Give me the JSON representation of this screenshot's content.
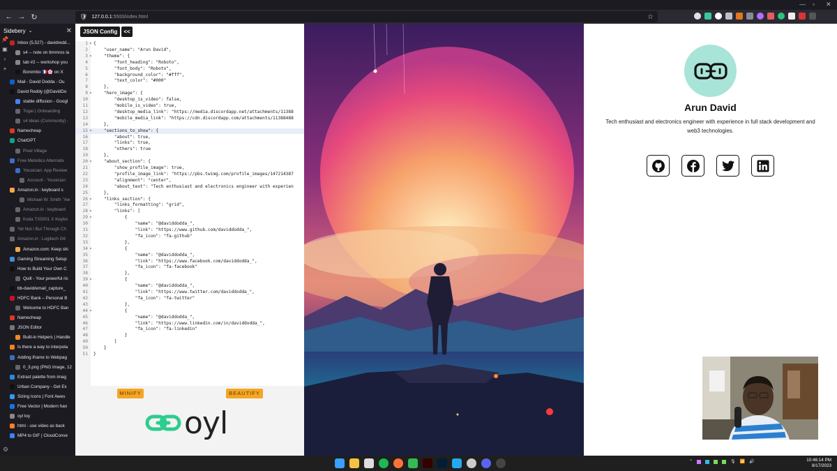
{
  "browser": {
    "url_host": "127.0.0.1",
    "url_rest": ":5500/index.html",
    "sidebar_title": "Sidebery"
  },
  "sidebar": {
    "items": [
      {
        "label": "Inbox (5,527) - davidredd...",
        "color": "#c5221f",
        "indent": 0
      },
      {
        "label": "s4 -- note on timmros la",
        "color": "#888888",
        "indent": 1
      },
      {
        "label": "tab #2 -- workshop you",
        "color": "#888888",
        "indent": 1
      },
      {
        "label": "Borombo 🇫🇷🌸 on X",
        "color": "#111111",
        "indent": 1
      },
      {
        "label": "Mail - David Dodda - Ou",
        "color": "#0a64c8",
        "indent": 0
      },
      {
        "label": "David Reddy (@DavidDo",
        "color": "#111111",
        "indent": 0
      },
      {
        "label": "stable diffusion - Googl",
        "color": "#4285f4",
        "indent": 1
      },
      {
        "label": "Togai | Onboarding",
        "color": "#666666",
        "indent": 1,
        "dim": true
      },
      {
        "label": "s4 ideas (Community) -",
        "color": "#666666",
        "indent": 1,
        "dim": true
      },
      {
        "label": "Namecheap",
        "color": "#de3723",
        "indent": 0
      },
      {
        "label": "ChatGPT",
        "color": "#10a37f",
        "indent": 0
      },
      {
        "label": "Pixel Village",
        "color": "#666666",
        "indent": 1,
        "dim": true
      },
      {
        "label": "Free Melodics Alternativ",
        "color": "#3d6dc5",
        "indent": 0,
        "dim": true
      },
      {
        "label": "Yousician: App Review",
        "color": "#3d6dc5",
        "indent": 1,
        "dim": true
      },
      {
        "label": "Account - Yousician",
        "color": "#666666",
        "indent": 2,
        "dim": true
      },
      {
        "label": "Amazon.in : keyboard s",
        "color": "#f3a847",
        "indent": 0
      },
      {
        "label": "Michael W. Smith \"Aw",
        "color": "#666666",
        "indent": 2,
        "dim": true
      },
      {
        "label": "Amazon.in : keyboard",
        "color": "#666666",
        "indent": 1,
        "dim": true
      },
      {
        "label": "Koda TX5001 X Keybo",
        "color": "#666666",
        "indent": 1,
        "dim": true
      },
      {
        "label": "Yet Not I But Through Ch",
        "color": "#666666",
        "indent": 0,
        "dim": true
      },
      {
        "label": "Amazon.in : Logitech G6",
        "color": "#666666",
        "indent": 0,
        "dim": true
      },
      {
        "label": "Amazon.com: Keep shi",
        "color": "#f3a847",
        "indent": 1
      },
      {
        "label": "Gaming Streaming Setup",
        "color": "#3f8fd8",
        "indent": 0
      },
      {
        "label": "How to Build Your Own C",
        "color": "#111111",
        "indent": 0
      },
      {
        "label": "Quill - Your powerful ric",
        "color": "#666666",
        "indent": 1
      },
      {
        "label": "bb-david/email_capture_",
        "color": "#111111",
        "indent": 0
      },
      {
        "label": "HDFC Bank – Personal B",
        "color": "#c8102e",
        "indent": 0
      },
      {
        "label": "Welcome to HDFC Ban",
        "color": "#666666",
        "indent": 1
      },
      {
        "label": "Namecheap",
        "color": "#de3723",
        "indent": 0
      },
      {
        "label": "JSON Editor",
        "color": "#777777",
        "indent": 0
      },
      {
        "label": "Built-in Helpers | Handle",
        "color": "#f08a24",
        "indent": 1
      },
      {
        "label": "Is there a way to interpola",
        "color": "#f48024",
        "indent": 0
      },
      {
        "label": "Adding iframe to Webpag",
        "color": "#3d6dc5",
        "indent": 0
      },
      {
        "label": "0_3.png (PNG Image, 12",
        "color": "#666666",
        "indent": 1
      },
      {
        "label": "Extract palette from imag",
        "color": "#2b88d8",
        "indent": 0
      },
      {
        "label": "Urban Company - Get Ex",
        "color": "#111111",
        "indent": 0
      },
      {
        "label": "Sizing Icons | Font Awes",
        "color": "#339af0",
        "indent": 0
      },
      {
        "label": "Free Vector | Modern han",
        "color": "#1273eb",
        "indent": 0
      },
      {
        "label": "oyl toy",
        "color": "#888888",
        "indent": 0
      },
      {
        "label": "html - use video as back",
        "color": "#f48024",
        "indent": 0
      },
      {
        "label": "MP4 to GIF | CloudConve",
        "color": "#3b82f6",
        "indent": 0
      }
    ]
  },
  "editor": {
    "json_config_label": "JSON Config",
    "collapse_label": "<<",
    "minify_label": "MINIFY",
    "beautify_label": "BEAUTIFY",
    "logo_text": "oyl",
    "active_line": 15,
    "lines": [
      {
        "n": "1",
        "fold": "▾",
        "text": "{"
      },
      {
        "n": "2",
        "fold": "",
        "text": "    \"user_name\": \"Arun David\","
      },
      {
        "n": "3",
        "fold": "▾",
        "text": "    \"theme\": {"
      },
      {
        "n": "4",
        "fold": "",
        "text": "        \"font_heading\": \"Roboto\","
      },
      {
        "n": "5",
        "fold": "",
        "text": "        \"font_body\": \"Roboto\","
      },
      {
        "n": "6",
        "fold": "",
        "text": "        \"background_color\": \"#fff\","
      },
      {
        "n": "7",
        "fold": "",
        "text": "        \"text_color\": \"#000\""
      },
      {
        "n": "8",
        "fold": "",
        "text": "    },"
      },
      {
        "n": "9",
        "fold": "▾",
        "text": "    \"hero_image\": {"
      },
      {
        "n": "10",
        "fold": "",
        "text": "        \"desktop_is_video\": false,"
      },
      {
        "n": "11",
        "fold": "",
        "text": "        \"mobile_is_video\": true,"
      },
      {
        "n": "12",
        "fold": "",
        "text": "        \"desktop_media_link\": \"https://media.discordapp.net/attachments/11388"
      },
      {
        "n": "13",
        "fold": "",
        "text": "        \"mobile_media_link\": \"https://cdn.discordapp.com/attachments/11388488"
      },
      {
        "n": "14",
        "fold": "",
        "text": "    },"
      },
      {
        "n": "15",
        "fold": "▾",
        "text": "    \"sections_to_show\": {"
      },
      {
        "n": "16",
        "fold": "",
        "text": "        \"about\": true,"
      },
      {
        "n": "17",
        "fold": "",
        "text": "        \"links\": true,"
      },
      {
        "n": "18",
        "fold": "",
        "text": "        \"others\": true"
      },
      {
        "n": "19",
        "fold": "",
        "text": "    },"
      },
      {
        "n": "20",
        "fold": "▾",
        "text": "    \"about_section\": {"
      },
      {
        "n": "21",
        "fold": "",
        "text": "        \"show_profile_image\": true,"
      },
      {
        "n": "22",
        "fold": "",
        "text": "        \"profile_image_link\": \"https://pbs.twimg.com/profile_images/147214387"
      },
      {
        "n": "23",
        "fold": "",
        "text": "        \"alignment\": \"center\","
      },
      {
        "n": "24",
        "fold": "",
        "text": "        \"about_text\": \"Tech enthusiast and electronics engineer with experien"
      },
      {
        "n": "25",
        "fold": "",
        "text": "    },"
      },
      {
        "n": "26",
        "fold": "▾",
        "text": "    \"links_section\": {"
      },
      {
        "n": "27",
        "fold": "",
        "text": "        \"links_formatting\": \"grid\","
      },
      {
        "n": "28",
        "fold": "▾",
        "text": "        \"links\": ["
      },
      {
        "n": "29",
        "fold": "▾",
        "text": "            {"
      },
      {
        "n": "30",
        "fold": "",
        "text": "                \"name\": \"@daviddodda_\","
      },
      {
        "n": "31",
        "fold": "",
        "text": "                \"link\": \"https://www.github.com/daviddodda_\","
      },
      {
        "n": "32",
        "fold": "",
        "text": "                \"fa_icon\": \"fa-github\""
      },
      {
        "n": "33",
        "fold": "",
        "text": "            },"
      },
      {
        "n": "34",
        "fold": "▾",
        "text": "            {"
      },
      {
        "n": "35",
        "fold": "",
        "text": "                \"name\": \"@daviddodda_\","
      },
      {
        "n": "36",
        "fold": "",
        "text": "                \"link\": \"https://www.facebook.com/daviddodda_\","
      },
      {
        "n": "37",
        "fold": "",
        "text": "                \"fa_icon\": \"fa-facebook\""
      },
      {
        "n": "38",
        "fold": "",
        "text": "            },"
      },
      {
        "n": "39",
        "fold": "▾",
        "text": "            {"
      },
      {
        "n": "40",
        "fold": "",
        "text": "                \"name\": \"@daviddodda_\","
      },
      {
        "n": "41",
        "fold": "",
        "text": "                \"link\": \"https://www.twitter.com/daviddodda_\","
      },
      {
        "n": "42",
        "fold": "",
        "text": "                \"fa_icon\": \"fa-twitter\""
      },
      {
        "n": "43",
        "fold": "",
        "text": "            },"
      },
      {
        "n": "44",
        "fold": "▾",
        "text": "            {"
      },
      {
        "n": "45",
        "fold": "",
        "text": "                \"name\": \"@daviddodda_\","
      },
      {
        "n": "46",
        "fold": "",
        "text": "                \"link\": \"https://www.linkedin.com/in/daviddodda_\","
      },
      {
        "n": "47",
        "fold": "",
        "text": "                \"fa_icon\": \"fa-linkedin\""
      },
      {
        "n": "48",
        "fold": "",
        "text": "            }"
      },
      {
        "n": "49",
        "fold": "",
        "text": "        ]"
      },
      {
        "n": "50",
        "fold": "",
        "text": "    }"
      },
      {
        "n": "51",
        "fold": "",
        "text": "}"
      }
    ]
  },
  "profile": {
    "name": "Arun David",
    "about": "Tech enthusiast and electronics engineer with experience in full stack development and web3 technologies.",
    "avatar_bg": "#a8e4d8",
    "links": [
      {
        "icon": "github-icon"
      },
      {
        "icon": "facebook-icon"
      },
      {
        "icon": "twitter-icon"
      },
      {
        "icon": "linkedin-icon"
      }
    ]
  },
  "taskbar": {
    "time": "10:46:14 PM",
    "date": "8/17/2023"
  },
  "colors": {
    "accent_orange": "#f5a623",
    "logo_green": "#2ecc8f"
  }
}
